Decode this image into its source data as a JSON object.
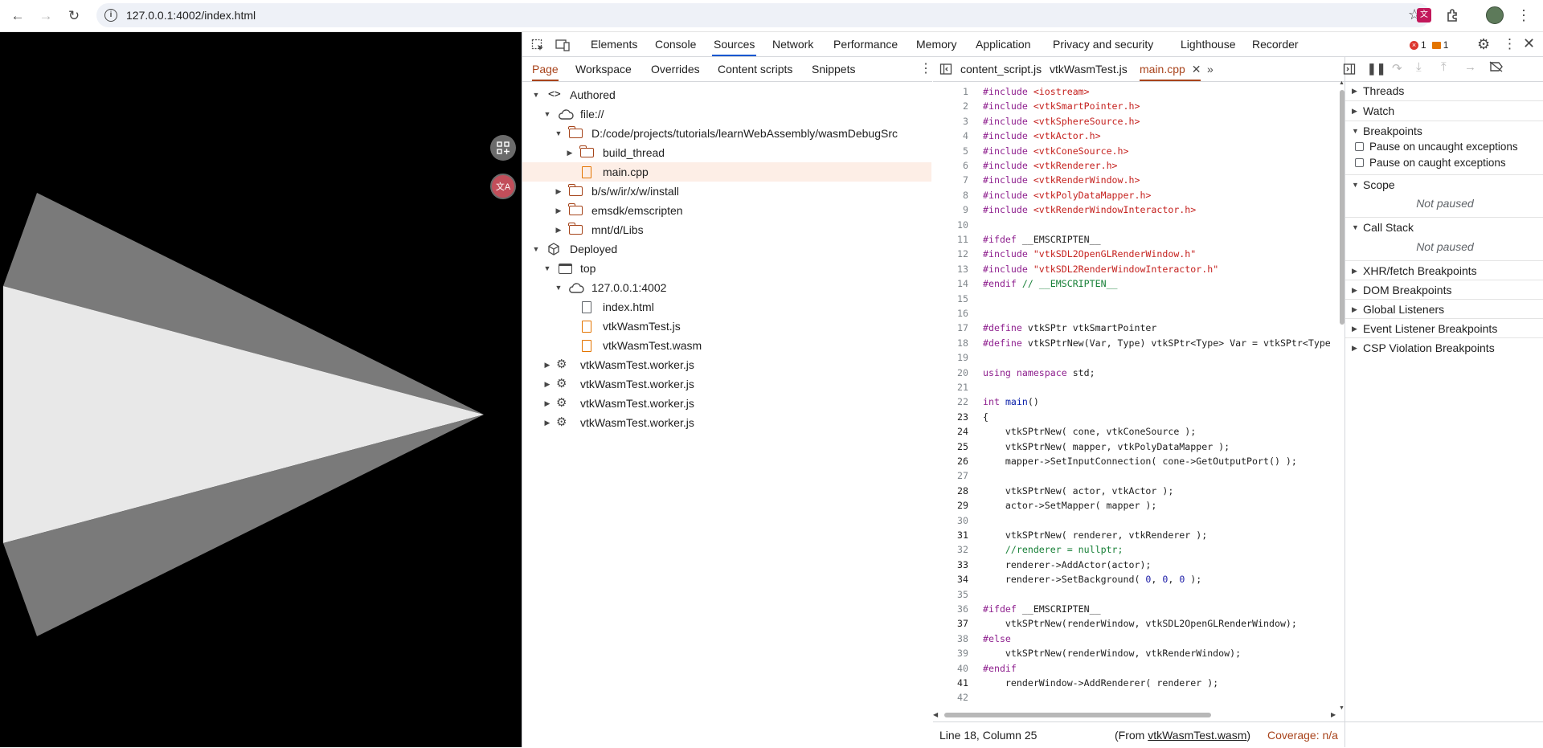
{
  "browser": {
    "url": "127.0.0.1:4002/index.html"
  },
  "devtools": {
    "panels": [
      "Elements",
      "Console",
      "Sources",
      "Network",
      "Performance",
      "Memory",
      "Application",
      "Privacy and security",
      "Lighthouse",
      "Recorder"
    ],
    "active_panel": "Sources",
    "error_count": "1",
    "message_count": "1",
    "navigator_tabs": [
      "Page",
      "Workspace",
      "Overrides",
      "Content scripts",
      "Snippets"
    ],
    "tree": {
      "authored": "Authored",
      "file_root": "file://",
      "src_path": "D:/code/projects/tutorials/learnWebAssembly/wasmDebugSrc",
      "build_thread": "build_thread",
      "main_cpp": "main.cpp",
      "install": "b/s/w/ir/x/w/install",
      "emsdk": "emsdk/emscripten",
      "libs": "mnt/d/Libs",
      "deployed": "Deployed",
      "top": "top",
      "host": "127.0.0.1:4002",
      "index_html": "index.html",
      "js": "vtkWasmTest.js",
      "wasm": "vtkWasmTest.wasm",
      "worker1": "vtkWasmTest.worker.js",
      "worker2": "vtkWasmTest.worker.js",
      "worker3": "vtkWasmTest.worker.js",
      "worker4": "vtkWasmTest.worker.js"
    },
    "editor_tabs": [
      "content_script.js",
      "vtkWasmTest.js",
      "main.cpp"
    ],
    "status": {
      "position": "Line 18, Column 25",
      "from_prefix": "(From ",
      "from_file": "vtkWasmTest.wasm",
      "from_suffix": ")",
      "coverage": "Coverage: n/a"
    },
    "debugger": {
      "threads": "Threads",
      "watch": "Watch",
      "breakpoints": "Breakpoints",
      "pause_uncaught": "Pause on uncaught exceptions",
      "pause_caught": "Pause on caught exceptions",
      "scope": "Scope",
      "scope_status": "Not paused",
      "call_stack": "Call Stack",
      "call_stack_status": "Not paused",
      "xhr": "XHR/fetch Breakpoints",
      "dom": "DOM Breakpoints",
      "global": "Global Listeners",
      "event": "Event Listener Breakpoints",
      "csp": "CSP Violation Breakpoints"
    }
  },
  "code_lines": [
    {
      "n": "1",
      "html": "<span class=\"pp\">#include</span> <span class=\"str\">&lt;iostream&gt;</span>"
    },
    {
      "n": "2",
      "html": "<span class=\"pp\">#include</span> <span class=\"str\">&lt;vtkSmartPointer.h&gt;</span>"
    },
    {
      "n": "3",
      "html": "<span class=\"pp\">#include</span> <span class=\"str\">&lt;vtkSphereSource.h&gt;</span>"
    },
    {
      "n": "4",
      "html": "<span class=\"pp\">#include</span> <span class=\"str\">&lt;vtkActor.h&gt;</span>"
    },
    {
      "n": "5",
      "html": "<span class=\"pp\">#include</span> <span class=\"str\">&lt;vtkConeSource.h&gt;</span>"
    },
    {
      "n": "6",
      "html": "<span class=\"pp\">#include</span> <span class=\"str\">&lt;vtkRenderer.h&gt;</span>"
    },
    {
      "n": "7",
      "html": "<span class=\"pp\">#include</span> <span class=\"str\">&lt;vtkRenderWindow.h&gt;</span>"
    },
    {
      "n": "8",
      "html": "<span class=\"pp\">#include</span> <span class=\"str\">&lt;vtkPolyDataMapper.h&gt;</span>"
    },
    {
      "n": "9",
      "html": "<span class=\"pp\">#include</span> <span class=\"str\">&lt;vtkRenderWindowInteractor.h&gt;</span>"
    },
    {
      "n": "10",
      "html": ""
    },
    {
      "n": "11",
      "html": "<span class=\"pp\">#ifdef</span> __EMSCRIPTEN__"
    },
    {
      "n": "12",
      "html": "<span class=\"pp\">#include</span> <span class=\"str\">\"vtkSDL2OpenGLRenderWindow.h\"</span>"
    },
    {
      "n": "13",
      "html": "<span class=\"pp\">#include</span> <span class=\"str\">\"vtkSDL2RenderWindowInteractor.h\"</span>"
    },
    {
      "n": "14",
      "html": "<span class=\"pp\">#endif</span> <span class=\"cm\">// __EMSCRIPTEN__</span>"
    },
    {
      "n": "15",
      "html": ""
    },
    {
      "n": "16",
      "html": ""
    },
    {
      "n": "17",
      "html": "<span class=\"pp\">#define</span> vtkSPtr vtkSmartPointer"
    },
    {
      "n": "18",
      "html": "<span class=\"pp\">#define</span> vtkSPtrNew(Var, Type) vtkSPtr&lt;Type&gt; Var = vtkSPtr&lt;Type"
    },
    {
      "n": "19",
      "html": ""
    },
    {
      "n": "20",
      "html": "<span class=\"kw\">using</span> <span class=\"kw\">namespace</span> std;"
    },
    {
      "n": "21",
      "html": ""
    },
    {
      "n": "22",
      "html": "<span class=\"kw\">int</span> <span class=\"kw2\">main</span>()"
    },
    {
      "n": "23",
      "html": "{"
    },
    {
      "n": "24",
      "html": "    vtkSPtrNew( cone, vtkConeSource );"
    },
    {
      "n": "25",
      "html": "    vtkSPtrNew( mapper, vtkPolyDataMapper );"
    },
    {
      "n": "26",
      "html": "    mapper-&gt;SetInputConnection( cone-&gt;GetOutputPort() );"
    },
    {
      "n": "27",
      "html": ""
    },
    {
      "n": "28",
      "html": "    vtkSPtrNew( actor, vtkActor );"
    },
    {
      "n": "29",
      "html": "    actor-&gt;SetMapper( mapper );"
    },
    {
      "n": "30",
      "html": ""
    },
    {
      "n": "31",
      "html": "    vtkSPtrNew( renderer, vtkRenderer );"
    },
    {
      "n": "32",
      "html": "    <span class=\"cm\">//renderer = nullptr;</span>"
    },
    {
      "n": "33",
      "html": "    renderer-&gt;AddActor(actor);"
    },
    {
      "n": "34",
      "html": "    renderer-&gt;SetBackground( <span class=\"num\">0</span>, <span class=\"num\">0</span>, <span class=\"num\">0</span> );"
    },
    {
      "n": "35",
      "html": ""
    },
    {
      "n": "36",
      "html": "<span class=\"pp\">#ifdef</span> __EMSCRIPTEN__"
    },
    {
      "n": "37",
      "html": "    vtkSPtrNew(renderWindow, vtkSDL2OpenGLRenderWindow);"
    },
    {
      "n": "38",
      "html": "<span class=\"pp\">#else</span>"
    },
    {
      "n": "39",
      "html": "    vtkSPtrNew(renderWindow, vtkRenderWindow);"
    },
    {
      "n": "40",
      "html": "<span class=\"pp\">#endif</span>"
    },
    {
      "n": "41",
      "html": "    renderWindow-&gt;AddRenderer( renderer );"
    },
    {
      "n": "42",
      "html": ""
    }
  ],
  "exec_lines": [
    "23",
    "24",
    "25",
    "26",
    "28",
    "29",
    "31",
    "33",
    "34",
    "37",
    "41"
  ],
  "colors": {
    "accent": "#0b57d0",
    "sources_accent": "#a8431b",
    "error": "#dc362e",
    "selection": "#fdeee6"
  }
}
